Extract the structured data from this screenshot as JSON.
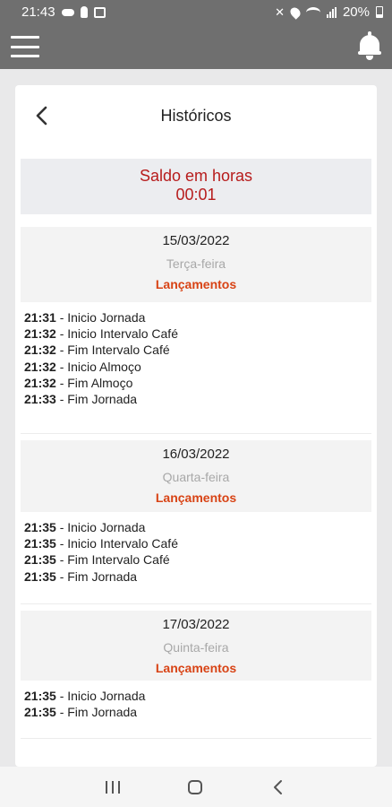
{
  "status_bar": {
    "time": "21:43",
    "battery": "20%"
  },
  "icons": {
    "menu": "hamburger-menu-icon",
    "notifications": "bell-icon",
    "back": "chevron-left-icon"
  },
  "colors": {
    "accent": "#b71c1c",
    "lancamentos": "#d84315",
    "bars": "#6f6f6f"
  },
  "page": {
    "title": "Históricos"
  },
  "saldo": {
    "label": "Saldo em horas",
    "value": "00:01"
  },
  "days": [
    {
      "date": "15/03/2022",
      "weekday": "Terça-feira",
      "section": "Lançamentos",
      "entries": [
        {
          "time": "21:31",
          "desc": " - Inicio Jornada"
        },
        {
          "time": "21:32",
          "desc": " - Inicio Intervalo Café"
        },
        {
          "time": "21:32",
          "desc": " - Fim Intervalo Café"
        },
        {
          "time": "21:32",
          "desc": " - Inicio Almoço"
        },
        {
          "time": "21:32",
          "desc": " - Fim Almoço"
        },
        {
          "time": "21:33",
          "desc": " - Fim Jornada"
        }
      ]
    },
    {
      "date": "16/03/2022",
      "weekday": "Quarta-feira",
      "section": "Lançamentos",
      "entries": [
        {
          "time": "21:35",
          "desc": " - Inicio Jornada"
        },
        {
          "time": "21:35",
          "desc": " - Inicio Intervalo Café"
        },
        {
          "time": "21:35",
          "desc": " - Fim Intervalo Café"
        },
        {
          "time": "21:35",
          "desc": " - Fim Jornada"
        }
      ]
    },
    {
      "date": "17/03/2022",
      "weekday": "Quinta-feira",
      "section": "Lançamentos",
      "entries": [
        {
          "time": "21:35",
          "desc": " - Inicio Jornada"
        },
        {
          "time": "21:35",
          "desc": " - Fim Jornada"
        }
      ]
    }
  ]
}
